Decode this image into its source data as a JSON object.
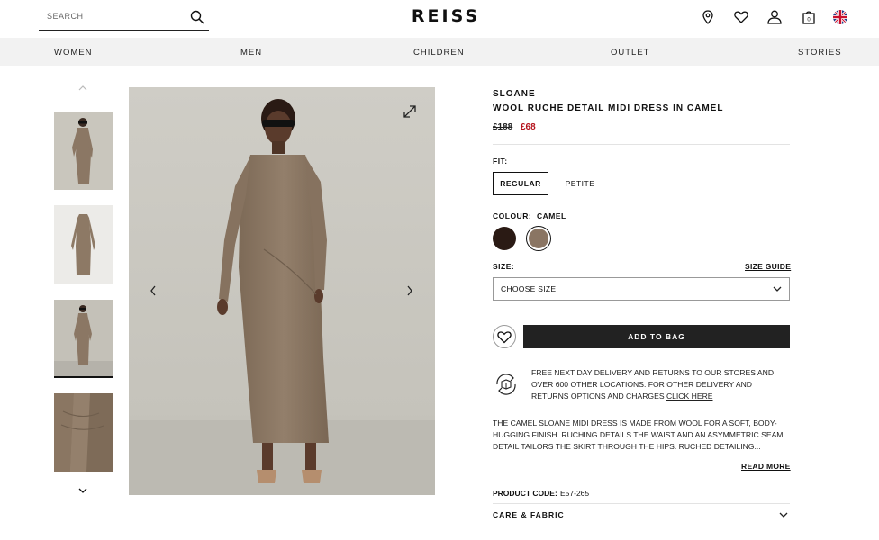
{
  "header": {
    "search_placeholder": "SEARCH",
    "logo": "REISS",
    "icons": [
      "location-pin-icon",
      "heart-icon",
      "user-icon",
      "bag-icon",
      "uk-flag-icon"
    ],
    "bag_count": "0"
  },
  "nav": {
    "items": [
      "WOMEN",
      "MEN",
      "CHILDREN",
      "OUTLET",
      "STORIES"
    ]
  },
  "product": {
    "brand": "SLOANE",
    "name": "WOOL RUCHE DETAIL MIDI DRESS IN CAMEL",
    "price_old": "£188",
    "price_new": "£68",
    "fit_label": "FIT:",
    "fit_options": [
      "REGULAR",
      "PETITE"
    ],
    "fit_selected": "REGULAR",
    "colour_label": "COLOUR:",
    "colour_value": "CAMEL",
    "swatches": [
      {
        "name": "dark-brown",
        "color": "#2a1a14"
      },
      {
        "name": "camel",
        "color": "#8a7563"
      }
    ],
    "size_label": "SIZE:",
    "size_guide": "SIZE GUIDE",
    "size_select": "CHOOSE SIZE",
    "add_to_bag": "ADD TO BAG",
    "delivery_text": "FREE NEXT DAY DELIVERY AND RETURNS TO OUR STORES AND OVER 600 OTHER LOCATIONS. FOR OTHER DELIVERY AND RETURNS OPTIONS AND CHARGES",
    "delivery_link": "CLICK HERE",
    "description": "THE CAMEL SLOANE MIDI DRESS IS MADE FROM WOOL FOR A SOFT, BODY-HUGGING FINISH. RUCHING DETAILS THE WAIST AND AN ASYMMETRIC SEAM DETAIL TAILORS THE SKIRT THROUGH THE HIPS. RUCHED DETAILING...",
    "read_more": "READ MORE",
    "product_code_label": "PRODUCT CODE:",
    "product_code": "E57-265",
    "care_label": "CARE & FABRIC"
  },
  "colors": {
    "accent_sale": "#b5121b",
    "button_dark": "#222222",
    "nav_bg": "#f2f2f2"
  }
}
